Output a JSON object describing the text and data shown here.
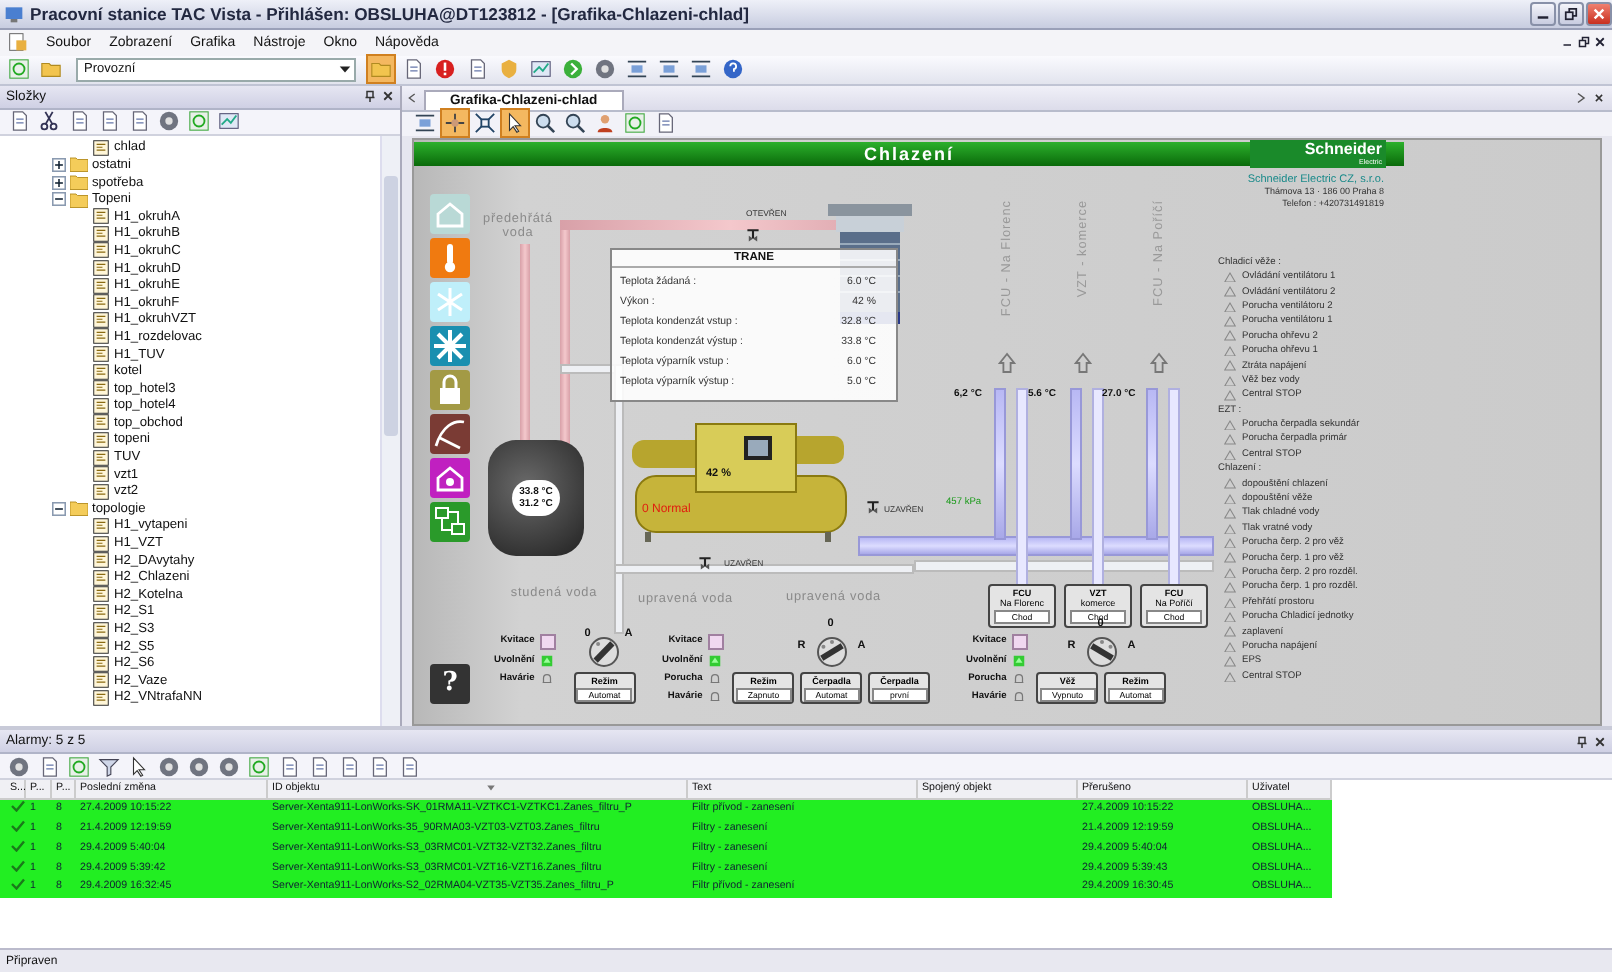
{
  "window": {
    "title": "Pracovní stanice TAC Vista - Přihlášen: OBSLUHA@DT123812 - [Grafika-Chlazeni-chlad]"
  },
  "menu": [
    "Soubor",
    "Zobrazení",
    "Grafika",
    "Nástroje",
    "Okno",
    "Nápověda"
  ],
  "toolbar": {
    "mode": "Provozní"
  },
  "folders": {
    "title": "Složky",
    "tree": [
      {
        "label": "chlad",
        "kind": "page"
      },
      {
        "label": "ostatni",
        "kind": "folder",
        "expanded": false
      },
      {
        "label": "spotřeba",
        "kind": "folder",
        "expanded": false
      },
      {
        "label": "Topeni",
        "kind": "folder",
        "expanded": true,
        "children": [
          {
            "label": "H1_okruhA",
            "kind": "page"
          },
          {
            "label": "H1_okruhB",
            "kind": "page"
          },
          {
            "label": "H1_okruhC",
            "kind": "page"
          },
          {
            "label": "H1_okruhD",
            "kind": "page"
          },
          {
            "label": "H1_okruhE",
            "kind": "page"
          },
          {
            "label": "H1_okruhF",
            "kind": "page"
          },
          {
            "label": "H1_okruhVZT",
            "kind": "page"
          },
          {
            "label": "H1_rozdelovac",
            "kind": "page"
          },
          {
            "label": "H1_TUV",
            "kind": "page"
          },
          {
            "label": "kotel",
            "kind": "page"
          },
          {
            "label": "top_hotel3",
            "kind": "page"
          },
          {
            "label": "top_hotel4",
            "kind": "page"
          },
          {
            "label": "top_obchod",
            "kind": "page"
          },
          {
            "label": "topeni",
            "kind": "page"
          },
          {
            "label": "TUV",
            "kind": "page"
          },
          {
            "label": "vzt1",
            "kind": "page"
          },
          {
            "label": "vzt2",
            "kind": "page"
          }
        ]
      },
      {
        "label": "topologie",
        "kind": "folder",
        "expanded": true,
        "children": [
          {
            "label": "H1_vytapeni",
            "kind": "page"
          },
          {
            "label": "H1_VZT",
            "kind": "page"
          },
          {
            "label": "H2_DAvytahy",
            "kind": "page"
          },
          {
            "label": "H2_Chlazeni",
            "kind": "page"
          },
          {
            "label": "H2_Kotelna",
            "kind": "page"
          },
          {
            "label": "H2_S1",
            "kind": "page"
          },
          {
            "label": "H2_S3",
            "kind": "page"
          },
          {
            "label": "H2_S5",
            "kind": "page"
          },
          {
            "label": "H2_S6",
            "kind": "page"
          },
          {
            "label": "H2_Vaze",
            "kind": "page"
          },
          {
            "label": "H2_VNtrafaNN",
            "kind": "page"
          }
        ]
      }
    ]
  },
  "document": {
    "tabs": [
      {
        "label": "Grafika-Chlazeni-chlad",
        "selected": true
      }
    ]
  },
  "diagram": {
    "header": "Chlazení",
    "logo": {
      "name": "Schneider",
      "sub": "Electric"
    },
    "company": [
      "Schneider Electric CZ, s.r.o.",
      "Thámova 13 · 186 00 Praha 8",
      "Telefon : +420731491819"
    ],
    "help_button": "?",
    "inlet_label": "předehřátá voda",
    "outlet_label": "studená voda",
    "treated_labels": [
      "upravená voda",
      "upravená voda"
    ],
    "valves": [
      {
        "label": "OTEVŘEN"
      },
      {
        "label": "UZAVŘEN"
      },
      {
        "label": "UZAVŘEN"
      }
    ],
    "tank": {
      "readings": [
        "33.8 °C",
        "31.2 °C"
      ]
    },
    "chiller": {
      "name": "TRANE",
      "load": "42 %",
      "status": "0 Normal",
      "rows": [
        {
          "label": "Teplota žádaná :",
          "value": "6.0 °C"
        },
        {
          "label": "Výkon :",
          "value": "42 %"
        },
        {
          "label": "Teplota kondenzát vstup :",
          "value": "32.8 °C"
        },
        {
          "label": "Teplota kondenzát výstup :",
          "value": "33.8 °C"
        },
        {
          "label": "Teplota výparník vstup :",
          "value": "6.0 °C"
        },
        {
          "label": "Teplota výparník výstup :",
          "value": "5.0 °C"
        }
      ]
    },
    "pressure": "457 kPa",
    "branches": [
      {
        "name": "FCU - Na Florenc",
        "temp": "6,2 °C",
        "button": {
          "title": "FCU",
          "sub": "Na Florenc",
          "state": "Chod"
        }
      },
      {
        "name": "VZT - komerce",
        "temp": "5.6 °C",
        "button": {
          "title": "VZT",
          "sub": "komerce",
          "state": "Chod"
        }
      },
      {
        "name": "FCU - Na Poříčí",
        "temp": "27.0 °C",
        "button": {
          "title": "FCU",
          "sub": "Na Poříčí",
          "state": "Chod"
        }
      }
    ],
    "alarm_groups": [
      {
        "title": "Chladicí věže :",
        "items": [
          "Ovládání ventilátoru 1",
          "Ovládání ventilátoru 2",
          "Porucha ventilátoru 2",
          "Porucha ventilátoru 1",
          "Porucha ohřevu 2",
          "Porucha ohřevu 1",
          "Ztráta napájení",
          "Věž bez vody",
          "Central STOP"
        ]
      },
      {
        "title": "EZT :",
        "items": [
          "Porucha čerpadla sekundár",
          "Porucha čerpadla primár",
          "Central STOP"
        ]
      },
      {
        "title": "Chlazení :",
        "items": [
          "dopouštění chlazení",
          "dopouštění věže",
          "Tlak chladné vody",
          "Tlak vratné vody",
          "Porucha čerp. 2 pro věž",
          "Porucha čerp. 1 pro věž",
          "Porucha čerp. 2 pro rozděl.",
          "Porucha čerp. 1 pro rozděl.",
          "Přehřátí prostoru",
          "Porucha Chladicí jednotky",
          "zaplavení",
          "Porucha napájení",
          "EPS",
          "Central STOP"
        ]
      }
    ],
    "control_groups": [
      {
        "indicators": [
          {
            "label": "Kvitace",
            "kind": "ack",
            "checked": false
          },
          {
            "label": "Uvolnění",
            "kind": "lamp",
            "on": true
          },
          {
            "label": "Havárie",
            "kind": "bell"
          }
        ],
        "switch": [
          {
            "label": "0",
            "selected": false
          },
          {
            "label": "A",
            "selected": true
          }
        ],
        "buttons": [
          {
            "title": "Režim",
            "value": "Automat"
          }
        ]
      },
      {
        "indicators": [
          {
            "label": "Kvitace",
            "kind": "ack",
            "checked": false
          },
          {
            "label": "Uvolnění",
            "kind": "lamp",
            "on": true
          },
          {
            "label": "Porucha",
            "kind": "bell"
          },
          {
            "label": "Havárie",
            "kind": "bell"
          }
        ],
        "switch": [
          {
            "label": "R",
            "selected": false
          },
          {
            "label": "0",
            "selected": false
          },
          {
            "label": "A",
            "selected": true
          }
        ],
        "buttons": [
          {
            "title": "Režim",
            "value": "Zapnuto"
          },
          {
            "title": "Čerpadla",
            "value": "Automat"
          },
          {
            "title": "Čerpadla",
            "value": "první"
          }
        ]
      },
      {
        "indicators": [
          {
            "label": "Kvitace",
            "kind": "ack",
            "checked": false
          },
          {
            "label": "Uvolnění",
            "kind": "lamp",
            "on": true
          },
          {
            "label": "Porucha",
            "kind": "bell"
          },
          {
            "label": "Havárie",
            "kind": "bell"
          }
        ],
        "switch": [
          {
            "label": "R",
            "selected": true
          },
          {
            "label": "0",
            "selected": false
          },
          {
            "label": "A",
            "selected": false
          }
        ],
        "buttons": [
          {
            "title": "Věž",
            "value": "Vypnuto"
          },
          {
            "title": "Režim",
            "value": "Automat"
          }
        ]
      }
    ]
  },
  "alarms": {
    "title": "Alarmy: 5 z 5",
    "columns": [
      "S...",
      "P...",
      "P...",
      "Poslední změna",
      "ID objektu",
      "Text",
      "Spojený objekt",
      "Přerušeno",
      "Uživatel"
    ],
    "rows": [
      [
        "",
        "1",
        "8",
        "27.4.2009 10:15:22",
        "Server-Xenta911-LonWorks-SK_01RMA11-VZTKC1-VZTKC1.Zanes_filtru_P",
        "Filtr přívod - zanesení",
        "",
        "27.4.2009 10:15:22",
        "OBSLUHA..."
      ],
      [
        "",
        "1",
        "8",
        "21.4.2009 12:19:59",
        "Server-Xenta911-LonWorks-35_90RMA03-VZT03-VZT03.Zanes_filtru",
        "Filtry - zanesení",
        "",
        "21.4.2009 12:19:59",
        "OBSLUHA..."
      ],
      [
        "",
        "1",
        "8",
        "29.4.2009 5:40:04",
        "Server-Xenta911-LonWorks-S3_03RMC01-VZT32-VZT32.Zanes_filtru",
        "Filtry - zanesení",
        "",
        "29.4.2009 5:40:04",
        "OBSLUHA..."
      ],
      [
        "",
        "1",
        "8",
        "29.4.2009 5:39:42",
        "Server-Xenta911-LonWorks-S3_03RMC01-VZT16-VZT16.Zanes_filtru",
        "Filtry - zanesení",
        "",
        "29.4.2009 5:39:43",
        "OBSLUHA..."
      ],
      [
        "",
        "1",
        "8",
        "29.4.2009 16:32:45",
        "Server-Xenta911-LonWorks-S2_02RMA04-VZT35-VZT35.Zanes_filtru_P",
        "Filtr přívod - zanesení",
        "",
        "29.4.2009 16:30:45",
        "OBSLUHA..."
      ]
    ]
  },
  "status_bar": "Připraven"
}
